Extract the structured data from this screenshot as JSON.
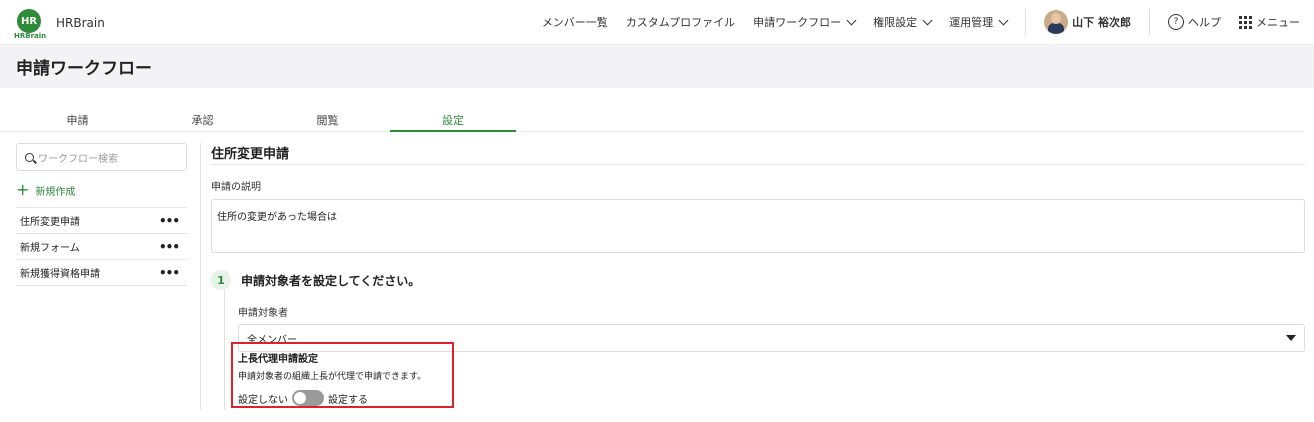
{
  "app": {
    "logo_text": "HR",
    "logo_sub": "HRBrain",
    "name": "HRBrain"
  },
  "nav": {
    "members": "メンバー一覧",
    "custom_profile": "カスタムプロファイル",
    "workflow": "申請ワークフロー",
    "permissions": "権限設定",
    "operations": "運用管理",
    "user_name": "山下 裕次郎",
    "help": "ヘルプ",
    "menu": "メニュー"
  },
  "page": {
    "title": "申請ワークフロー"
  },
  "tabs": [
    {
      "label": "申請"
    },
    {
      "label": "承認"
    },
    {
      "label": "閲覧"
    },
    {
      "label": "設定",
      "active": true
    }
  ],
  "sidebar": {
    "search_placeholder": "ワークフロー検索",
    "new_label": "新規作成",
    "items": [
      {
        "label": "住所変更申請",
        "more": "•••"
      },
      {
        "label": "新規フォーム",
        "more": "•••"
      },
      {
        "label": "新規獲得資格申請",
        "more": "•••"
      }
    ]
  },
  "workflow": {
    "title": "住所変更申請",
    "description_label": "申請の説明",
    "description": "住所の変更があった場合は",
    "step_number": "1",
    "step_title": "申請対象者を設定してください。",
    "target_label": "申請対象者",
    "target_value": "全メンバー",
    "proxy": {
      "title": "上長代理申請設定",
      "description": "申請対象者の組織上長が代理で申請できます。",
      "off_label": "設定しない",
      "on_label": "設定する",
      "enabled": false
    }
  },
  "colors": {
    "accent": "#2e8b3a",
    "highlight": "#e0202a"
  }
}
